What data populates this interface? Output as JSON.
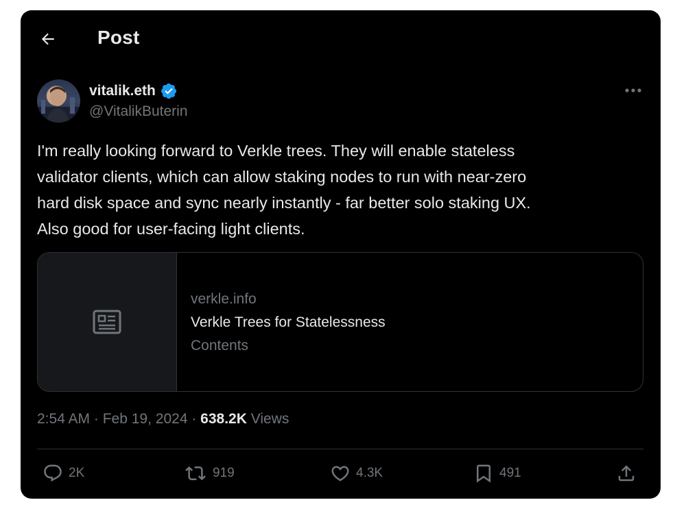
{
  "header": {
    "title": "Post"
  },
  "author": {
    "name": "vitalik.eth",
    "handle": "@VitalikButerin"
  },
  "tweet": {
    "lines": [
      "I'm really looking forward to Verkle trees. They will enable stateless",
      "validator clients, which can allow staking nodes to run with near-zero",
      "hard disk space and sync nearly instantly - far better solo staking UX.",
      "Also good for user-facing light clients."
    ]
  },
  "link_card": {
    "domain": "verkle.info",
    "title": "Verkle Trees for Statelessness",
    "description": "Contents"
  },
  "meta": {
    "time": "2:54 AM",
    "separator": " · ",
    "date": "Feb 19, 2024",
    "separator2": " · ",
    "views_count": "638.2K",
    "views_label": " Views"
  },
  "actions": {
    "replies": "2K",
    "reposts": "919",
    "likes": "4.3K",
    "bookmarks": "491"
  },
  "colors": {
    "background": "#000000",
    "text_primary": "#e7e9ea",
    "text_secondary": "#71767b",
    "border": "#2f3336",
    "verified": "#1d9bf0"
  },
  "icons": [
    "back-arrow-icon",
    "verified-badge-icon",
    "more-icon",
    "article-icon",
    "reply-icon",
    "repost-icon",
    "like-icon",
    "bookmark-icon",
    "share-icon"
  ]
}
